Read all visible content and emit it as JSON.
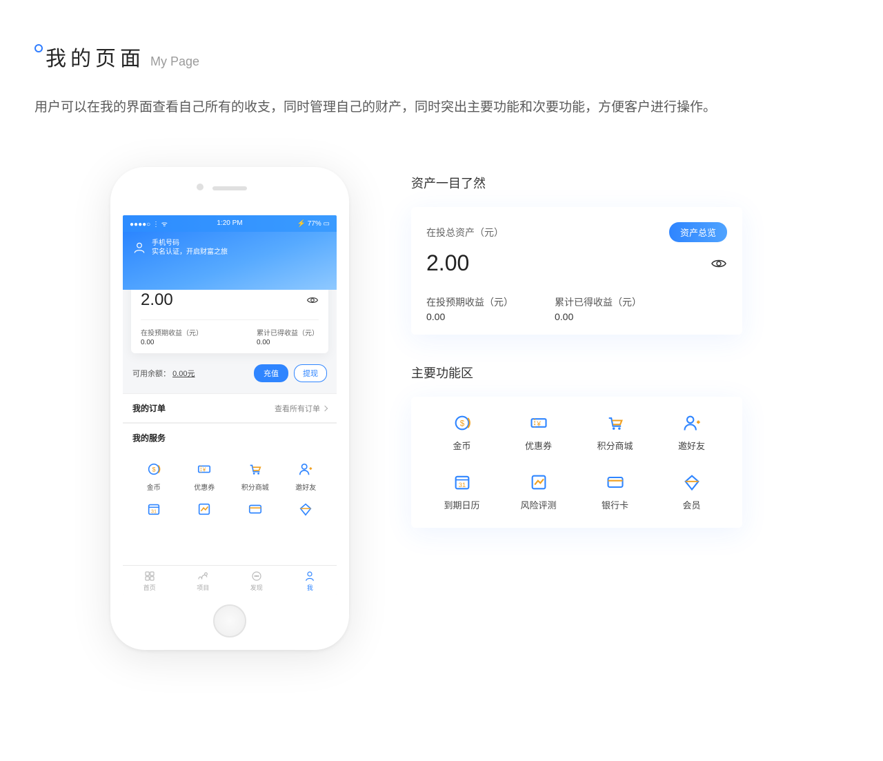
{
  "page": {
    "title_main": "我的页面",
    "title_sub": "My Page",
    "description": "用户可以在我的界面查看自己所有的收支，同时管理自己的财产，同时突出主要功能和次要功能，方便客户进行操作。"
  },
  "phone": {
    "status": {
      "left": "●●●●○ ⋮ ᯤ",
      "time": "1:20 PM",
      "right": "⚡ 77% ▭"
    },
    "user": {
      "line1": "手机号码",
      "line2": "实名认证，开启财富之旅"
    },
    "asset": {
      "label": "在投总资产（元）",
      "overview_btn": "资产总览",
      "amount": "2.00",
      "col1_label": "在投预期收益（元）",
      "col1_value": "0.00",
      "col2_label": "累计已得收益（元）",
      "col2_value": "0.00"
    },
    "balance": {
      "label": "可用余额：",
      "value": "0.00元",
      "recharge": "充值",
      "withdraw": "提现"
    },
    "orders": {
      "title": "我的订单",
      "link": "查看所有订单"
    },
    "services_title": "我的服务",
    "services": [
      {
        "label": "金币"
      },
      {
        "label": "优惠券"
      },
      {
        "label": "积分商城"
      },
      {
        "label": "邀好友"
      },
      {
        "label": "到期日历"
      },
      {
        "label": "风险评测"
      },
      {
        "label": "银行卡"
      },
      {
        "label": "会员"
      }
    ],
    "tabs": [
      {
        "label": "首页"
      },
      {
        "label": "项目"
      },
      {
        "label": "发现"
      },
      {
        "label": "我"
      }
    ]
  },
  "right": {
    "heading1": "资产一目了然",
    "asset": {
      "label": "在投总资产（元）",
      "overview_btn": "资产总览",
      "amount": "2.00",
      "col1_label": "在投预期收益（元）",
      "col1_value": "0.00",
      "col2_label": "累计已得收益（元）",
      "col2_value": "0.00"
    },
    "heading2": "主要功能区",
    "services": [
      {
        "label": "金币"
      },
      {
        "label": "优惠券"
      },
      {
        "label": "积分商城"
      },
      {
        "label": "邀好友"
      },
      {
        "label": "到期日历"
      },
      {
        "label": "风险评测"
      },
      {
        "label": "银行卡"
      },
      {
        "label": "会员"
      }
    ]
  }
}
